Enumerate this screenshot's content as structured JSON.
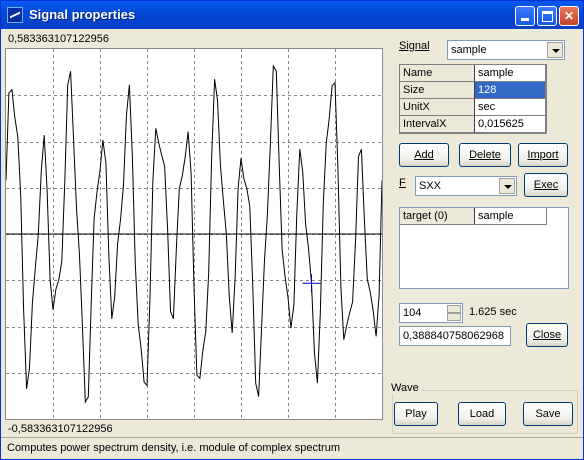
{
  "window": {
    "title": "Signal properties"
  },
  "plot": {
    "y_max_label": "0,583363107122956",
    "y_min_label": "-0,583363107122956",
    "size": 128,
    "cursor_index": 104
  },
  "panel": {
    "signal_label": "Signal",
    "signal_value": "sample",
    "properties": [
      {
        "key": "Name",
        "value": "sample"
      },
      {
        "key": "Size",
        "value": "128"
      },
      {
        "key": "UnitX",
        "value": "sec"
      },
      {
        "key": "IntervalX",
        "value": "0,015625"
      }
    ],
    "add_label": "Add",
    "delete_label": "Delete",
    "import_label": "Import",
    "function_label": "F",
    "function_value": "SXX",
    "exec_label": "Exec",
    "targets": [
      {
        "key": "target (0)",
        "value": "sample"
      }
    ],
    "index_value": "104",
    "time_text": "1.625 sec",
    "value_text": "0,388840758062968",
    "close_label": "Close",
    "wave_label": "Wave",
    "play_label": "Play",
    "load_label": "Load",
    "save_label": "Save"
  },
  "status": {
    "text": "Computes power spectrum density, i.e. module of complex spectrum"
  },
  "colors": {
    "title_bar": "#0a5bf0",
    "selection": "#316ac5",
    "cursor": "#0000c0"
  }
}
